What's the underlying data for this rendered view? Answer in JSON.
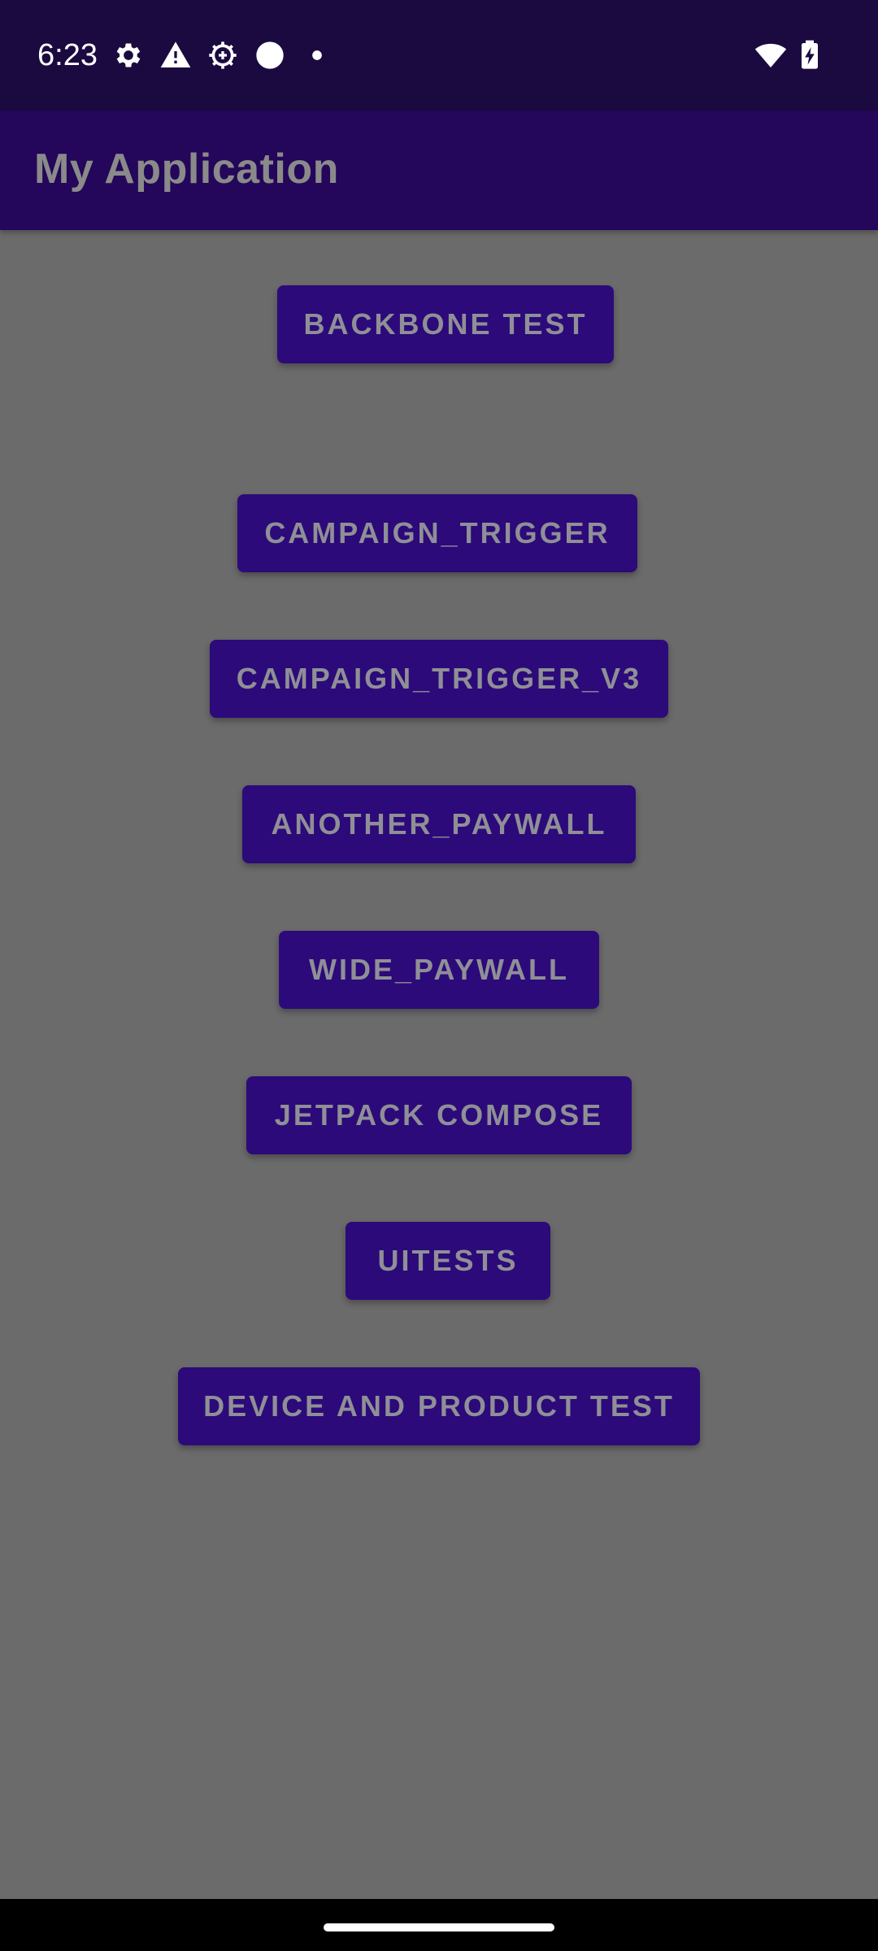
{
  "status_bar": {
    "time": "6:23",
    "icons": [
      "settings-gear-icon",
      "warning-triangle-icon",
      "debug-gear-icon",
      "circle-icon",
      "dot-icon",
      "wifi-icon",
      "battery-charging-icon"
    ]
  },
  "app_bar": {
    "title": "My Application"
  },
  "buttons": [
    {
      "label": "BACKBONE TEST"
    },
    {
      "label": "CAMPAIGN_TRIGGER"
    },
    {
      "label": "CAMPAIGN_TRIGGER_V3"
    },
    {
      "label": "ANOTHER_PAYWALL"
    },
    {
      "label": "WIDE_PAYWALL"
    },
    {
      "label": "JETPACK COMPOSE"
    },
    {
      "label": "UITESTS"
    },
    {
      "label": "DEVICE AND PRODUCT TEST"
    }
  ],
  "colors": {
    "status_bar": "#1b0a40",
    "app_bar": "#24065a",
    "background": "#6b6b6b",
    "button": "#2c0a7a",
    "button_text": "#8f8f96"
  }
}
